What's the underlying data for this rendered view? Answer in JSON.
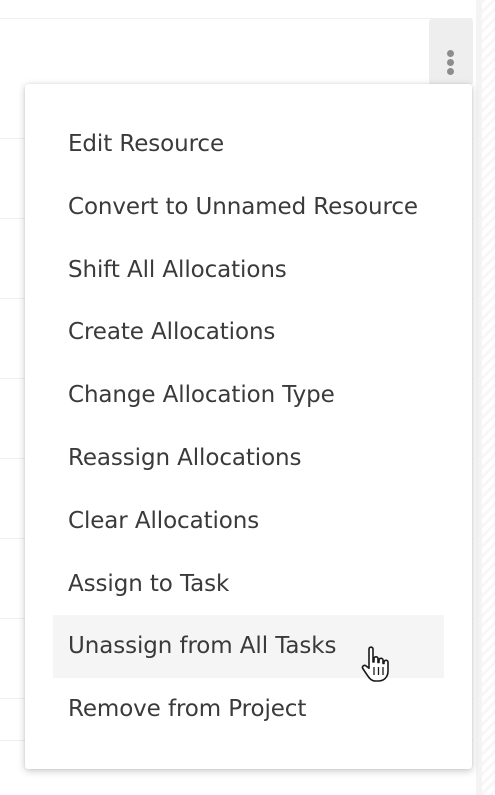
{
  "toolbar": {
    "more_icon": "more-vertical-icon"
  },
  "menu": {
    "items": [
      {
        "label": "Edit Resource"
      },
      {
        "label": "Convert to Unnamed Resource"
      },
      {
        "label": "Shift All Allocations"
      },
      {
        "label": "Create Allocations"
      },
      {
        "label": "Change Allocation Type"
      },
      {
        "label": "Reassign Allocations"
      },
      {
        "label": "Clear Allocations"
      },
      {
        "label": "Assign to Task"
      },
      {
        "label": "Unassign from All Tasks",
        "hovered": true
      },
      {
        "label": "Remove from Project"
      }
    ]
  },
  "colors": {
    "text": "#3a3a3a",
    "hover_background": "#f5f5f5",
    "button_background": "#eeeeee",
    "icon_gray": "#8d8d8d"
  },
  "cursor": {
    "icon": "hand-pointer-icon"
  }
}
